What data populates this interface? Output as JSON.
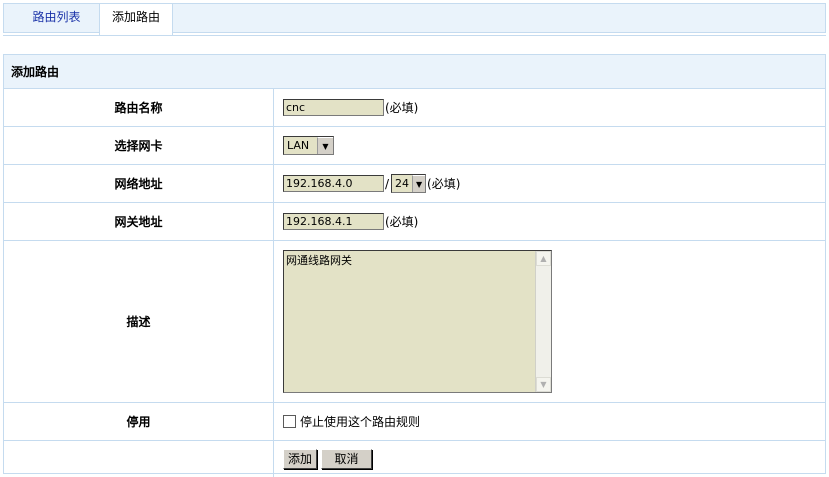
{
  "tabs": {
    "route_list": "路由列表",
    "add_route": "添加路由"
  },
  "panel": {
    "title": "添加路由"
  },
  "form": {
    "route_name": {
      "label": "路由名称",
      "value": "cnc",
      "hint": "(必填)"
    },
    "nic": {
      "label": "选择网卡",
      "selected": "LAN"
    },
    "network": {
      "label": "网络地址",
      "value": "192.168.4.0",
      "separator": "/",
      "mask": "24",
      "hint": "(必填)"
    },
    "gateway": {
      "label": "网关地址",
      "value": "192.168.4.1",
      "hint": "(必填)"
    },
    "description": {
      "label": "描述",
      "value": "网通线路网关"
    },
    "disable": {
      "label": "停用",
      "checkbox_label": "停止使用这个路由规则",
      "checked": false
    },
    "buttons": {
      "add": "添加",
      "cancel": "取消"
    }
  },
  "icons": {
    "dropdown": "chevron-down-icon",
    "scroll_up": "arrow-up-icon",
    "scroll_down": "arrow-down-icon"
  },
  "colors": {
    "header_bg": "#eaf3fb",
    "border": "#c5dbef",
    "input_bg": "#e3e2c6",
    "link": "#1a32a8"
  }
}
